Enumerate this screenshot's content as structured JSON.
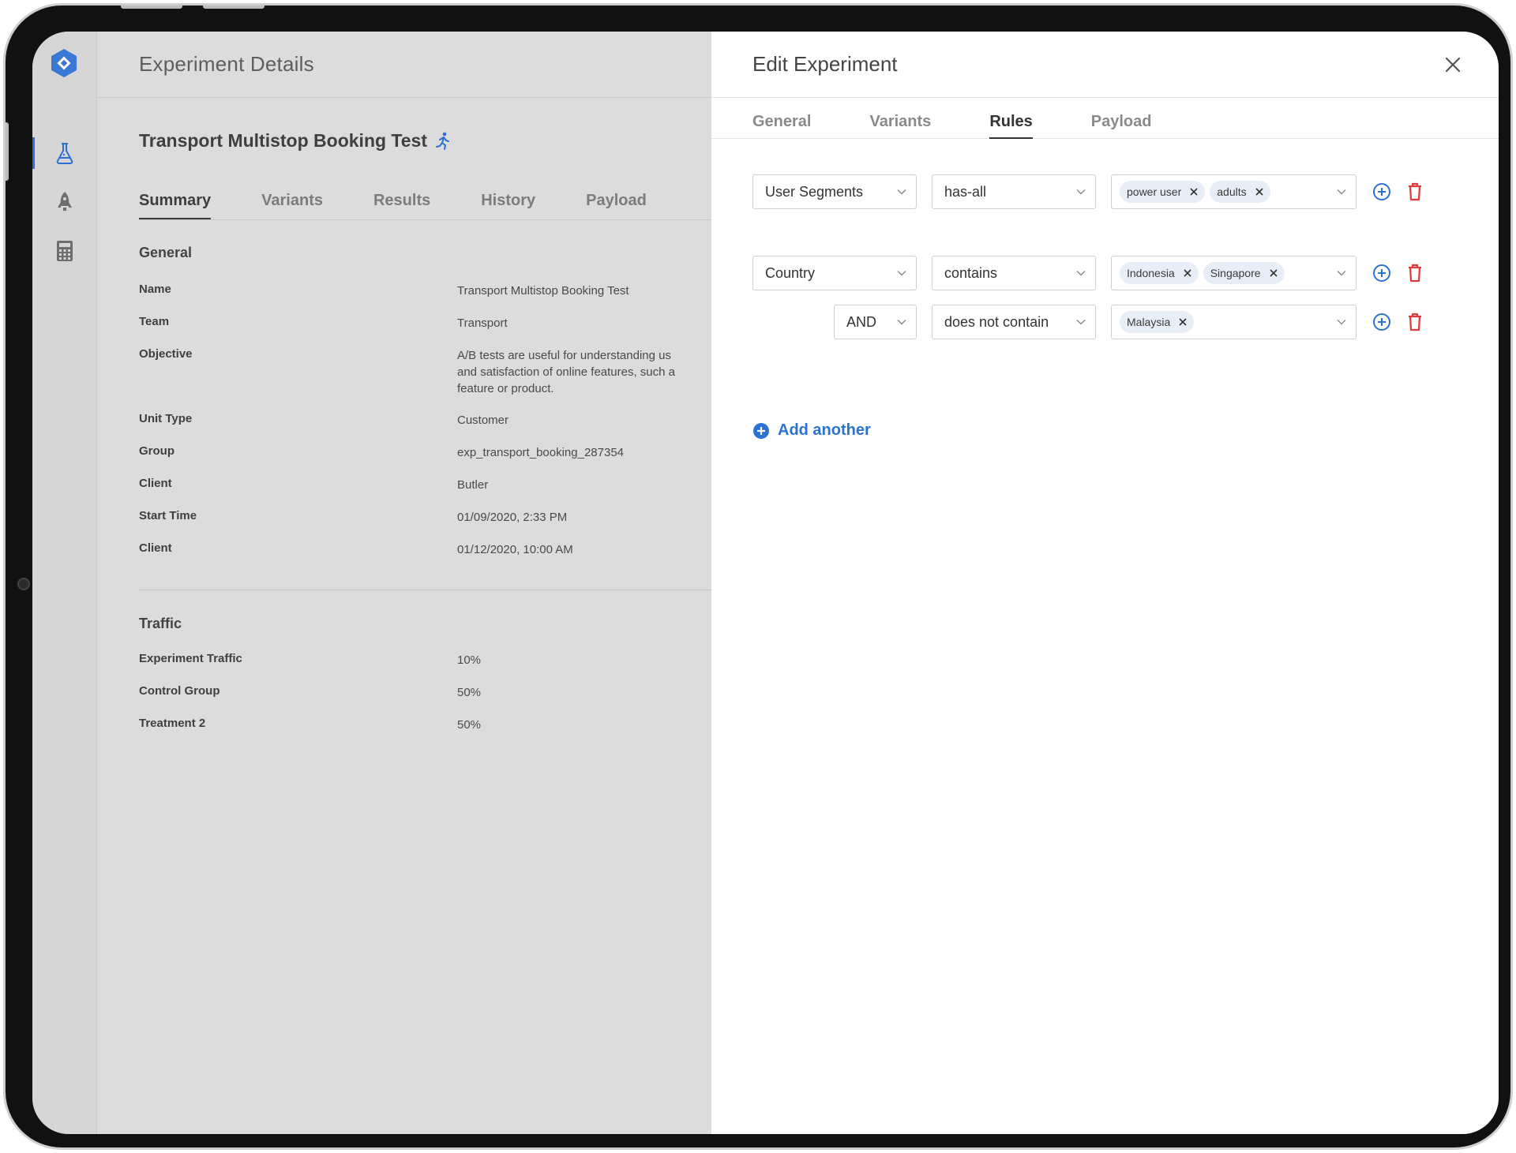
{
  "colors": {
    "accent": "#2a72d4",
    "danger": "#e13a3a"
  },
  "nav": {
    "items": [
      {
        "icon": "flask-icon",
        "active": true
      },
      {
        "icon": "rocket-icon",
        "active": false
      },
      {
        "icon": "calculator-icon",
        "active": false
      }
    ]
  },
  "page": {
    "title": "Experiment Details",
    "experiment_title": "Transport Multistop Booking Test",
    "status_icon": "running-icon",
    "tabs": [
      "Summary",
      "Variants",
      "Results",
      "History",
      "Payload"
    ],
    "active_tab": "Summary",
    "general": {
      "heading": "General",
      "rows": [
        {
          "label": "Name",
          "value": "Transport Multistop Booking Test"
        },
        {
          "label": "Team",
          "value": "Transport"
        },
        {
          "label": "Objective",
          "value": "A/B tests are useful for understanding us\nand satisfaction of online features, such a\nfeature or product."
        },
        {
          "label": "Unit Type",
          "value": "Customer"
        },
        {
          "label": "Group",
          "value": "exp_transport_booking_287354"
        },
        {
          "label": "Client",
          "value": "Butler"
        },
        {
          "label": "Start Time",
          "value": "01/09/2020, 2:33 PM"
        },
        {
          "label": "Client",
          "value": "01/12/2020, 10:00 AM"
        }
      ]
    },
    "traffic": {
      "heading": "Traffic",
      "rows": [
        {
          "label": "Experiment Traffic",
          "value": "10%"
        },
        {
          "label": "Control Group",
          "value": "50%"
        },
        {
          "label": "Treatment 2",
          "value": "50%"
        }
      ]
    }
  },
  "drawer": {
    "title": "Edit Experiment",
    "tabs": [
      "General",
      "Variants",
      "Rules",
      "Payload"
    ],
    "active_tab": "Rules",
    "rules": [
      {
        "attribute": "User Segments",
        "operator": "has-all",
        "values": [
          "power user",
          "adults"
        ]
      },
      {
        "attribute": "Country",
        "operator": "contains",
        "values": [
          "Indonesia",
          "Singapore"
        ]
      },
      {
        "connector": "AND",
        "operator": "does not contain",
        "values": [
          "Malaysia"
        ]
      }
    ],
    "add_another_label": "Add another"
  }
}
